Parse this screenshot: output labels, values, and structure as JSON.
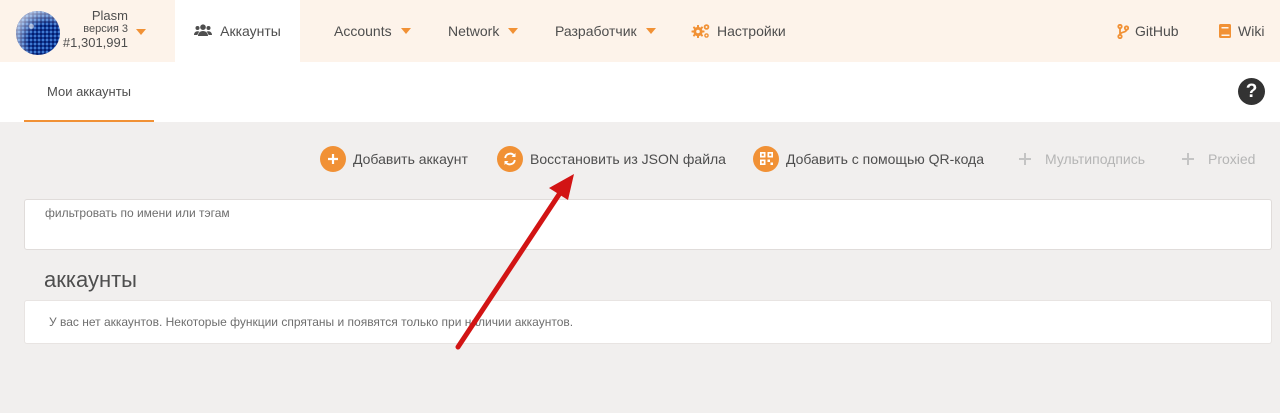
{
  "chain": {
    "name": "Plasm",
    "version": "версия 3",
    "block": "#1,301,991"
  },
  "nav": {
    "accounts_ru": "Аккаунты",
    "accounts": "Accounts",
    "network": "Network",
    "developer": "Разработчик",
    "settings": "Настройки",
    "github": "GitHub",
    "wiki": "Wiki"
  },
  "tabs": {
    "my_accounts": "Мои аккаунты"
  },
  "help": {
    "glyph": "?"
  },
  "actions": {
    "add_account": "Добавить аккаунт",
    "restore_json": "Восстановить из JSON файла",
    "add_qr": "Добавить с помощью QR-кода",
    "multisig": "Мультиподпись",
    "proxied": "Proxied"
  },
  "filter": {
    "label": "фильтровать по имени или тэгам"
  },
  "accounts_section": {
    "title": "аккаунты",
    "empty": "У вас нет аккаунтов. Некоторые функции спрятаны и появятся только при наличии аккаунтов."
  },
  "colors": {
    "accent": "#f19135",
    "topbar_bg": "#fdf3ea",
    "page_bg": "#f1efee",
    "annotation_arrow": "#d21414"
  }
}
